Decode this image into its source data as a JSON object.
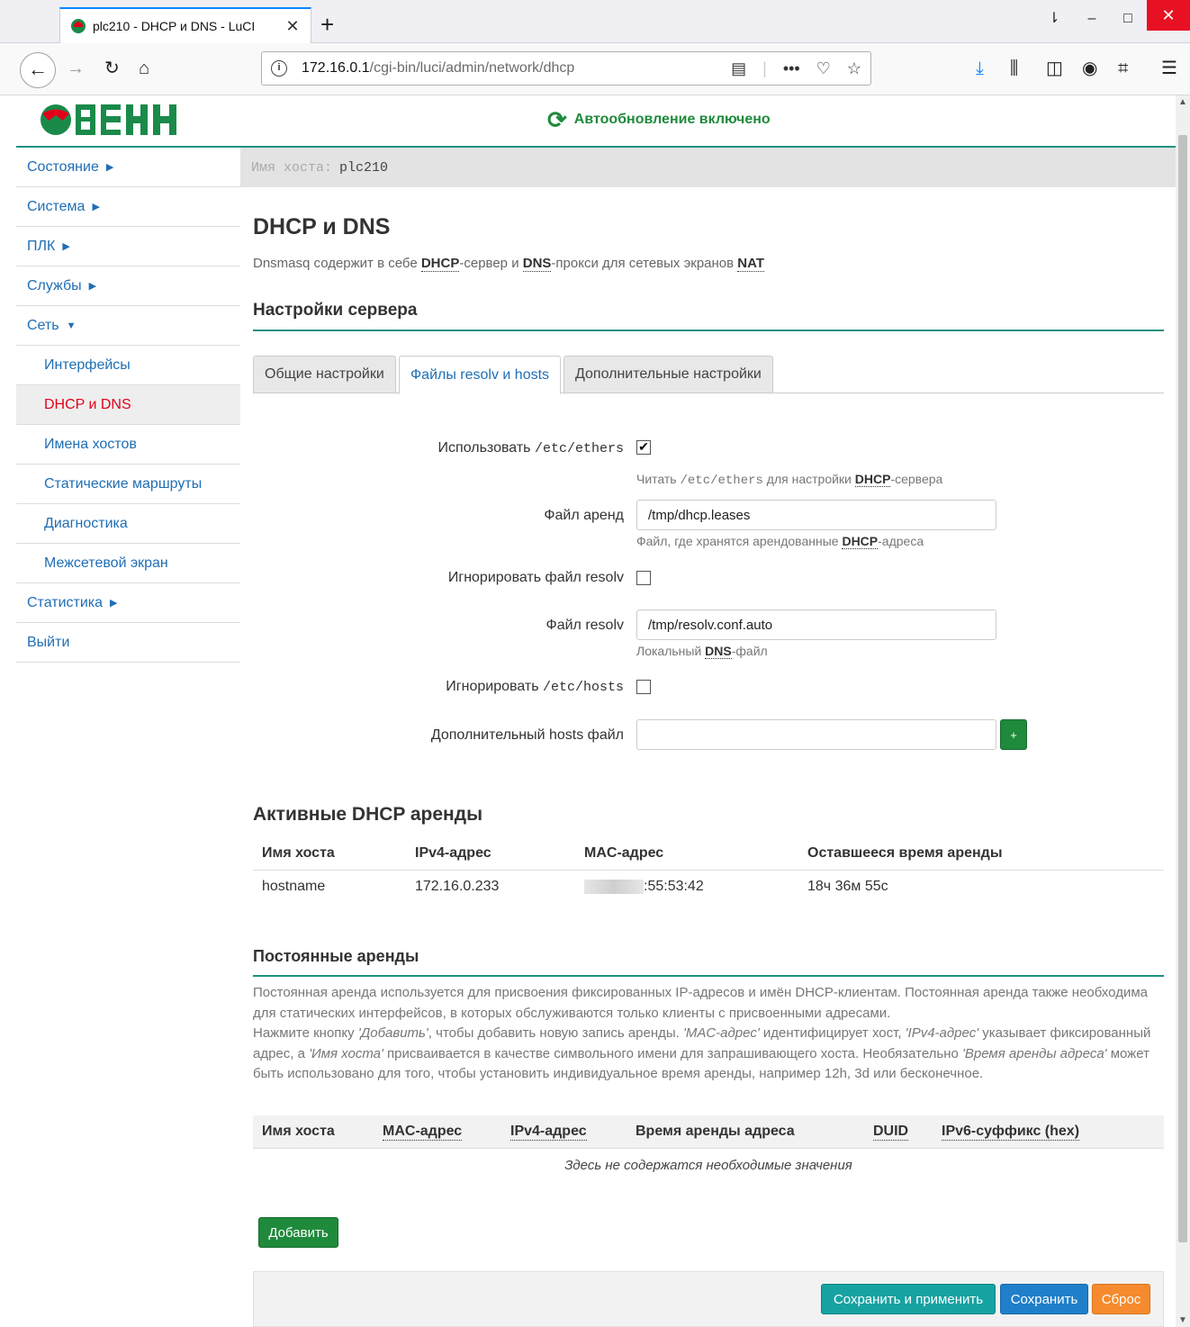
{
  "browser": {
    "tab_title": "plc210 - DHCP и DNS - LuCI",
    "url_host": "172.16.0.1",
    "url_path": "/cgi-bin/luci/admin/network/dhcp"
  },
  "header": {
    "logo_text": "ОВЕН",
    "autorefresh": "Автообновление включено"
  },
  "sidebar": {
    "items": [
      {
        "label": "Состояние",
        "caret": "▶"
      },
      {
        "label": "Система",
        "caret": "▶"
      },
      {
        "label": "ПЛК",
        "caret": "▶"
      },
      {
        "label": "Службы",
        "caret": "▶"
      },
      {
        "label": "Сеть",
        "caret": "▼"
      },
      {
        "label": "Интерфейсы"
      },
      {
        "label": "DHCP и DNS"
      },
      {
        "label": "Имена хостов"
      },
      {
        "label": "Статические маршруты"
      },
      {
        "label": "Диагностика"
      },
      {
        "label": "Межсетевой экран"
      },
      {
        "label": "Статистика",
        "caret": "▶"
      },
      {
        "label": "Выйти"
      }
    ]
  },
  "hostbar": {
    "label": "Имя хоста:",
    "value": "plc210"
  },
  "page": {
    "title": "DHCP и DNS",
    "desc_1": "Dnsmasq содержит в себе ",
    "desc_dhcp": "DHCP",
    "desc_2": "-сервер и ",
    "desc_dns": "DNS",
    "desc_3": "-прокси для сетевых экранов ",
    "desc_nat": "NAT"
  },
  "server_settings": {
    "title": "Настройки сервера",
    "tabs": [
      "Общие настройки",
      "Файлы resolv и hosts",
      "Дополнительные настройки"
    ]
  },
  "form": {
    "use_ethers_label": "Использовать ",
    "use_ethers_code": "/etc/ethers",
    "use_ethers_checked": "✔",
    "use_ethers_hint_1": "Читать ",
    "use_ethers_hint_code": "/etc/ethers",
    "use_ethers_hint_2": " для настройки ",
    "use_ethers_hint_abbr": "DHCP",
    "use_ethers_hint_3": "-сервера",
    "leasefile_label": "Файл аренд",
    "leasefile_value": "/tmp/dhcp.leases",
    "leasefile_hint_1": "Файл, где хранятся арендованные ",
    "leasefile_hint_abbr": "DHCP",
    "leasefile_hint_2": "-адреса",
    "noresolv_label": "Игнорировать файл resolv",
    "resolvfile_label": "Файл resolv",
    "resolvfile_value": "/tmp/resolv.conf.auto",
    "resolvfile_hint_1": "Локальный ",
    "resolvfile_hint_abbr": "DNS",
    "resolvfile_hint_2": "-файл",
    "nohosts_label": "Игнорировать ",
    "nohosts_code": "/etc/hosts",
    "addnhosts_label": "Дополнительный hosts файл",
    "addnhosts_value": "",
    "add_plus": "+"
  },
  "active_leases": {
    "title": "Активные DHCP аренды",
    "columns": [
      "Имя хоста",
      "IPv4-адрес",
      "MAC-адрес",
      "Оставшееся время аренды"
    ],
    "rows": [
      {
        "hostname": "hostname",
        "ipv4": "172.16.0.233",
        "mac_visible": ":55:53:42",
        "remaining": "18ч 36м 55с"
      }
    ]
  },
  "static_leases": {
    "title": "Постоянные аренды",
    "desc_line1": "Постоянная аренда используется для присвоения фиксированных IP-адресов и имён DHCP-клиентам. Постоянная аренда также необходима для статических интерфейсов, в которых обслуживаются только клиенты с присвоенными адресами.",
    "desc_p1": "Нажмите кнопку ",
    "desc_add": "'Добавить'",
    "desc_p2": ", чтобы добавить новую запись аренды. ",
    "desc_mac": "'MAC-адрес'",
    "desc_p3": " идентифицирует хост, ",
    "desc_ipv4": "'IPv4-адрес'",
    "desc_p4": " указывает фиксированный адрес, а ",
    "desc_name": "'Имя хоста'",
    "desc_p5": " присваивается в качестве символьного имени для запрашивающего хоста. Необязательно ",
    "desc_time": "'Время аренды адреса'",
    "desc_p6": " может быть использовано для того, чтобы установить индивидуальное время аренды, например 12h, 3d или бесконечное.",
    "columns": [
      "Имя хоста",
      "MAC-адрес",
      "IPv4-адрес",
      "Время аренды адреса",
      "DUID",
      "IPv6-суффикс (hex)"
    ],
    "empty_text": "Здесь не содержатся необходимые значения",
    "add_button": "Добавить"
  },
  "footer": {
    "save_apply": "Сохранить и применить",
    "save": "Сохранить",
    "reset": "Сброс"
  },
  "colors": {
    "accent_teal": "#1a9180",
    "link_blue": "#1f6eb5",
    "active_red": "#e2001a",
    "green": "#1f8a3c"
  }
}
